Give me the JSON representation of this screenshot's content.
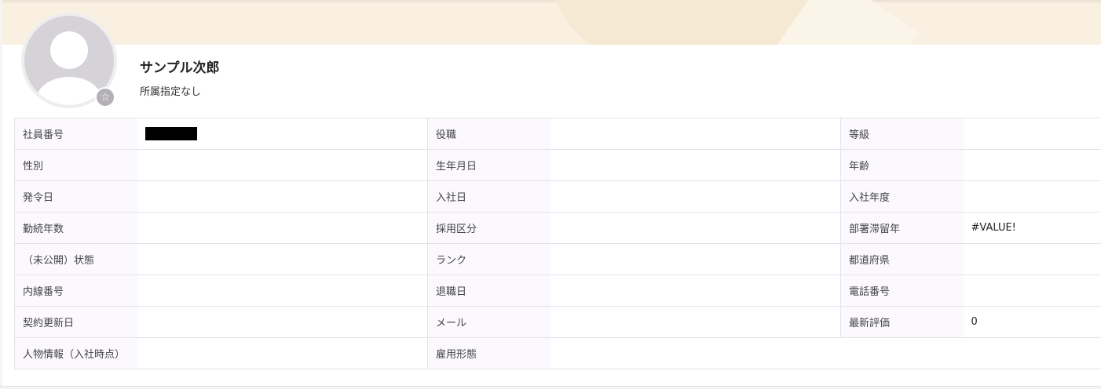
{
  "profile": {
    "name": "サンプル次郎",
    "department": "所属指定なし",
    "favorite_icon": "☆"
  },
  "fields": [
    [
      {
        "label": "社員番号",
        "value": "",
        "redacted": true
      },
      {
        "label": "役職",
        "value": ""
      },
      {
        "label": "等級",
        "value": ""
      }
    ],
    [
      {
        "label": "性別",
        "value": ""
      },
      {
        "label": "生年月日",
        "value": ""
      },
      {
        "label": "年齢",
        "value": ""
      }
    ],
    [
      {
        "label": "発令日",
        "value": ""
      },
      {
        "label": "入社日",
        "value": ""
      },
      {
        "label": "入社年度",
        "value": ""
      }
    ],
    [
      {
        "label": "勤続年数",
        "value": ""
      },
      {
        "label": "採用区分",
        "value": ""
      },
      {
        "label": "部署滞留年",
        "value": "#VALUE!"
      }
    ],
    [
      {
        "label": "（未公開）状態",
        "value": ""
      },
      {
        "label": "ランク",
        "value": ""
      },
      {
        "label": "都道府県",
        "value": ""
      }
    ],
    [
      {
        "label": "内線番号",
        "value": ""
      },
      {
        "label": "退職日",
        "value": ""
      },
      {
        "label": "電話番号",
        "value": ""
      }
    ],
    [
      {
        "label": "契約更新日",
        "value": ""
      },
      {
        "label": "メール",
        "value": ""
      },
      {
        "label": "最新評価",
        "value": "0"
      }
    ],
    [
      {
        "label": "人物情報（入社時点）",
        "value": ""
      },
      {
        "label": "雇用形態",
        "value": ""
      }
    ]
  ],
  "colors": {
    "banner": "#f9f0e1",
    "label_bg": "#fbf9fd",
    "border": "#e3e3e8",
    "avatar_bg": "#d6d3d8"
  }
}
